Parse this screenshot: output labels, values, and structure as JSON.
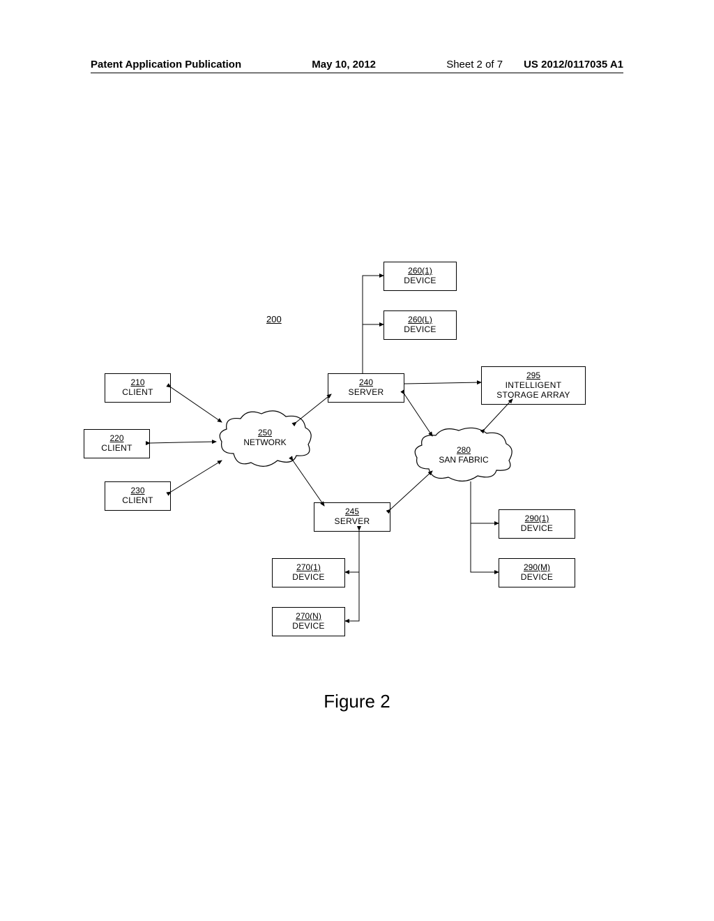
{
  "header": {
    "left": "Patent Application Publication",
    "date": "May 10, 2012",
    "sheet": "Sheet 2 of 7",
    "pubnum": "US 2012/0117035 A1"
  },
  "diagram_ref": "200",
  "figure_caption": "Figure 2",
  "nodes": {
    "client210": {
      "ref": "210",
      "lbl": "CLIENT"
    },
    "client220": {
      "ref": "220",
      "lbl": "CLIENT"
    },
    "client230": {
      "ref": "230",
      "lbl": "CLIENT"
    },
    "network": {
      "ref": "250",
      "lbl": "NETWORK"
    },
    "server240": {
      "ref": "240",
      "lbl": "SERVER"
    },
    "server245": {
      "ref": "245",
      "lbl": "SERVER"
    },
    "sanfabric": {
      "ref": "280",
      "lbl": "SAN FABRIC"
    },
    "device2601": {
      "ref": "260(1)",
      "lbl": "DEVICE"
    },
    "device260L": {
      "ref": "260(L)",
      "lbl": "DEVICE"
    },
    "device2701": {
      "ref": "270(1)",
      "lbl": "DEVICE"
    },
    "device270N": {
      "ref": "270(N)",
      "lbl": "DEVICE"
    },
    "device2901": {
      "ref": "290(1)",
      "lbl": "DEVICE"
    },
    "device290M": {
      "ref": "290(M)",
      "lbl": "DEVICE"
    },
    "isa": {
      "ref": "295",
      "lbl": "INTELLIGENT",
      "lbl2": "STORAGE ARRAY"
    }
  },
  "chart_data": {
    "type": "diagram",
    "title": "Figure 2 — Network architecture 200",
    "nodes": [
      {
        "id": "210",
        "label": "CLIENT",
        "kind": "box"
      },
      {
        "id": "220",
        "label": "CLIENT",
        "kind": "box"
      },
      {
        "id": "230",
        "label": "CLIENT",
        "kind": "box"
      },
      {
        "id": "250",
        "label": "NETWORK",
        "kind": "cloud"
      },
      {
        "id": "240",
        "label": "SERVER",
        "kind": "box"
      },
      {
        "id": "245",
        "label": "SERVER",
        "kind": "box"
      },
      {
        "id": "280",
        "label": "SAN FABRIC",
        "kind": "cloud"
      },
      {
        "id": "260(1)",
        "label": "DEVICE",
        "kind": "box"
      },
      {
        "id": "260(L)",
        "label": "DEVICE",
        "kind": "box"
      },
      {
        "id": "270(1)",
        "label": "DEVICE",
        "kind": "box"
      },
      {
        "id": "270(N)",
        "label": "DEVICE",
        "kind": "box"
      },
      {
        "id": "290(1)",
        "label": "DEVICE",
        "kind": "box"
      },
      {
        "id": "290(M)",
        "label": "DEVICE",
        "kind": "box"
      },
      {
        "id": "295",
        "label": "INTELLIGENT STORAGE ARRAY",
        "kind": "box"
      }
    ],
    "edges": [
      {
        "from": "210",
        "to": "250",
        "bidir": true
      },
      {
        "from": "220",
        "to": "250",
        "bidir": true
      },
      {
        "from": "230",
        "to": "250",
        "bidir": true
      },
      {
        "from": "250",
        "to": "240",
        "bidir": true
      },
      {
        "from": "250",
        "to": "245",
        "bidir": true
      },
      {
        "from": "240",
        "to": "260(1)",
        "bidir": false
      },
      {
        "from": "240",
        "to": "260(L)",
        "bidir": false
      },
      {
        "from": "240",
        "to": "280",
        "bidir": true
      },
      {
        "from": "240",
        "to": "295",
        "bidir": false
      },
      {
        "from": "245",
        "to": "270(1)",
        "bidir": true
      },
      {
        "from": "245",
        "to": "270(N)",
        "bidir": true
      },
      {
        "from": "245",
        "to": "280",
        "bidir": true
      },
      {
        "from": "280",
        "to": "290(1)",
        "bidir": false
      },
      {
        "from": "280",
        "to": "290(M)",
        "bidir": false
      },
      {
        "from": "280",
        "to": "295",
        "bidir": true
      }
    ]
  }
}
